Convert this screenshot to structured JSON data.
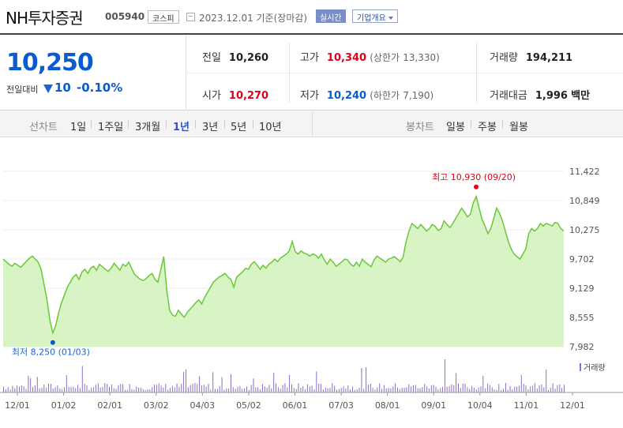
{
  "header": {
    "stock_name": "NH투자증권",
    "stock_code": "005940",
    "market": "코스피",
    "date_text": "2023.12.01 기준(장마감)",
    "realtime_label": "실시간",
    "company_label": "기업개요"
  },
  "summary": {
    "now_price": "10,250",
    "change_label": "전일대비",
    "change_value": "10",
    "change_rate": "-0.10%",
    "prev_close_label": "전일",
    "prev_close": "10,260",
    "high_label": "고가",
    "high": "10,340",
    "upper_limit_label": "(상한가",
    "upper_limit": "13,330)",
    "volume_label": "거래량",
    "volume": "194,211",
    "open_label": "시가",
    "open": "10,270",
    "low_label": "저가",
    "low": "10,240",
    "lower_limit_label": "(하한가",
    "lower_limit": "7,190)",
    "amount_label": "거래대금",
    "amount": "1,996",
    "amount_unit": "백만"
  },
  "toolbar": {
    "line_chart_label": "선차트",
    "periods": [
      "1일",
      "1주일",
      "3개월",
      "1년",
      "3년",
      "5년",
      "10년"
    ],
    "active_period": "1년",
    "candle_chart_label": "봉차트",
    "candles": [
      "일봉",
      "주봉",
      "월봉"
    ]
  },
  "colors": {
    "up": "#e0001b",
    "down": "#0a5bd0",
    "line": "#6ac83a",
    "fill": "#d8f3c4",
    "volume": "#8a6fc4"
  },
  "chart_data": {
    "type": "area",
    "ylim": [
      7982,
      11422
    ],
    "yticks": [
      "11,422",
      "10,849",
      "10,275",
      "9,702",
      "9,129",
      "8,555",
      "7,982"
    ],
    "ytick_values": [
      11422,
      10849,
      10275,
      9702,
      9129,
      8555,
      7982
    ],
    "xticks": [
      "12/01",
      "01/02",
      "02/01",
      "03/02",
      "04/03",
      "05/02",
      "06/01",
      "07/03",
      "08/01",
      "09/01",
      "10/04",
      "11/01",
      "12/01"
    ],
    "max_annotation": "최고 10,930 (09/20)",
    "min_annotation": "최저 8,250 (01/03)",
    "volume_legend": "거래량",
    "price": [
      9702,
      9650,
      9600,
      9560,
      9620,
      9580,
      9540,
      9600,
      9660,
      9720,
      9760,
      9700,
      9640,
      9500,
      9200,
      8900,
      8500,
      8250,
      8400,
      8650,
      8850,
      9000,
      9150,
      9250,
      9350,
      9400,
      9300,
      9450,
      9500,
      9420,
      9520,
      9560,
      9480,
      9600,
      9550,
      9500,
      9460,
      9520,
      9620,
      9550,
      9480,
      9600,
      9560,
      9640,
      9520,
      9400,
      9350,
      9300,
      9280,
      9320,
      9380,
      9420,
      9300,
      9250,
      9500,
      9750,
      9100,
      8700,
      8600,
      8580,
      8700,
      8620,
      8560,
      8650,
      8720,
      8780,
      8850,
      8900,
      8820,
      8950,
      9050,
      9150,
      9250,
      9300,
      9350,
      9380,
      9420,
      9350,
      9300,
      9150,
      9350,
      9400,
      9450,
      9520,
      9500,
      9600,
      9650,
      9580,
      9500,
      9580,
      9520,
      9600,
      9640,
      9700,
      9650,
      9720,
      9760,
      9800,
      9860,
      10050,
      9850,
      9800,
      9860,
      9820,
      9800,
      9760,
      9800,
      9780,
      9720,
      9800,
      9680,
      9600,
      9700,
      9640,
      9560,
      9600,
      9650,
      9700,
      9680,
      9600,
      9560,
      9640,
      9560,
      9700,
      9640,
      9600,
      9550,
      9680,
      9760,
      9720,
      9680,
      9640,
      9700,
      9720,
      9750,
      9700,
      9650,
      9740,
      10050,
      10250,
      10400,
      10350,
      10300,
      10380,
      10320,
      10250,
      10300,
      10380,
      10340,
      10260,
      10300,
      10450,
      10380,
      10320,
      10400,
      10500,
      10600,
      10700,
      10620,
      10530,
      10580,
      10800,
      10930,
      10700,
      10480,
      10350,
      10200,
      10300,
      10500,
      10700,
      10600,
      10450,
      10250,
      10050,
      9900,
      9800,
      9750,
      9700,
      9800,
      9900,
      10200,
      10300,
      10250,
      10300,
      10400,
      10350,
      10400,
      10380,
      10350,
      10420,
      10400,
      10300,
      10250
    ]
  }
}
